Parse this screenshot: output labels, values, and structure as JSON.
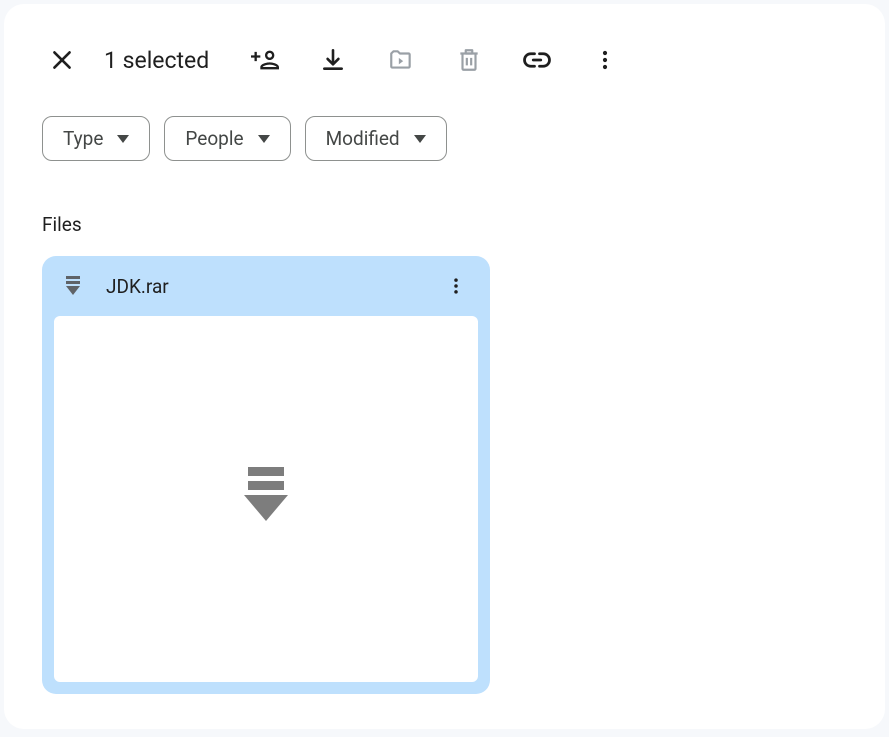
{
  "toolbar": {
    "selected_text": "1 selected"
  },
  "filters": {
    "type": "Type",
    "people": "People",
    "modified": "Modified"
  },
  "section": {
    "files_label": "Files"
  },
  "file": {
    "name": "JDK.rar"
  }
}
